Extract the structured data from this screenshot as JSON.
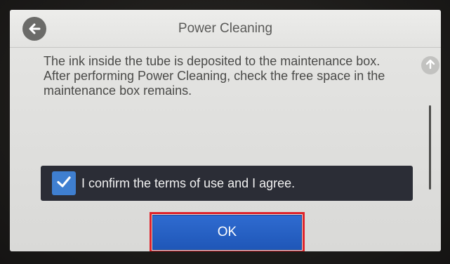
{
  "header": {
    "title": "Power Cleaning",
    "back_icon": "arrow-left-circle-icon"
  },
  "message": {
    "line1": "The ink inside the tube is deposited to the maintenance box.",
    "line2": "After performing Power Cleaning, check the free space in the maintenance box remains."
  },
  "scroll": {
    "up_icon": "arrow-up-circle-icon"
  },
  "confirm": {
    "checked": true,
    "label": "I confirm the terms of use and I agree."
  },
  "ok_button": {
    "label": "OK"
  },
  "colors": {
    "accent_blue": "#1f57b8",
    "highlight_red": "#e0242b",
    "confirm_bar": "#2b2d36"
  }
}
